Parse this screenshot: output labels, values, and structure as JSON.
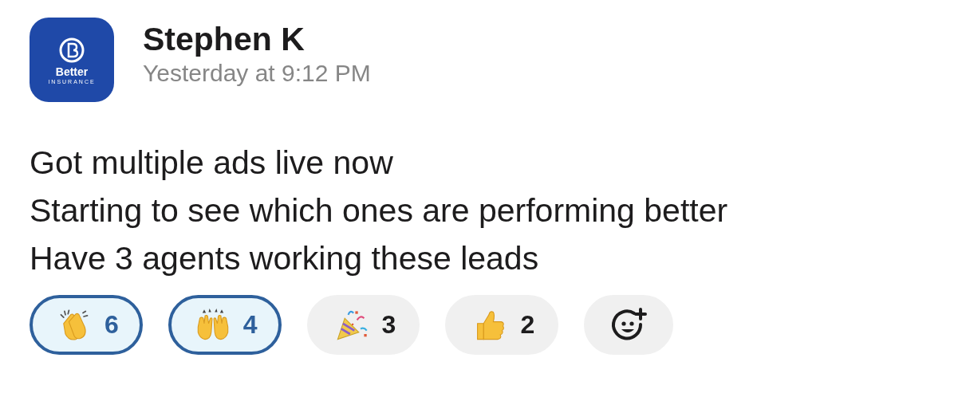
{
  "message": {
    "avatar": {
      "brand": "Better",
      "tagline": "INSURANCE"
    },
    "author": "Stephen K",
    "timestamp": "Yesterday at 9:12 PM",
    "lines": [
      "Got multiple ads live now",
      "Starting to see which ones are performing better",
      "Have 3 agents working these leads"
    ],
    "reactions": [
      {
        "kind": "clap",
        "count": "6",
        "selected": true
      },
      {
        "kind": "raised",
        "count": "4",
        "selected": true
      },
      {
        "kind": "party",
        "count": "3",
        "selected": false
      },
      {
        "kind": "thumbs",
        "count": "2",
        "selected": false
      }
    ]
  }
}
